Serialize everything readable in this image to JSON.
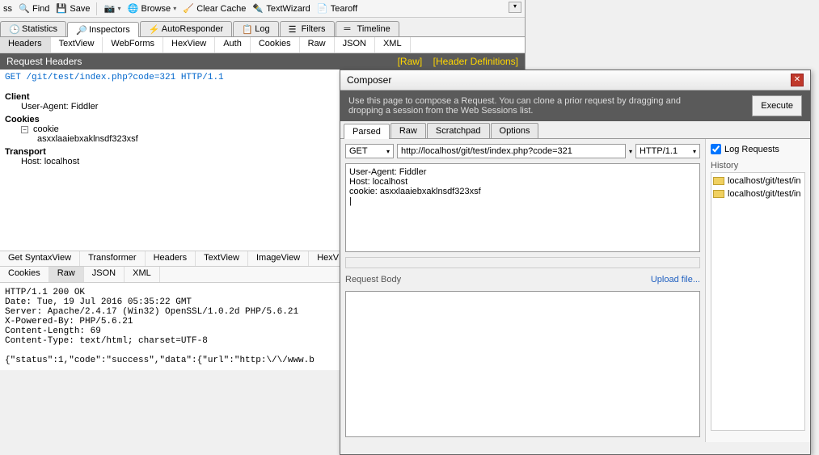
{
  "toolbar": {
    "ss_label": "ss",
    "find_label": "Find",
    "save_label": "Save",
    "browse_label": "Browse",
    "clearcache_label": "Clear Cache",
    "textwizard_label": "TextWizard",
    "tearoff_label": "Tearoff"
  },
  "top_tabs": {
    "statistics": "Statistics",
    "inspectors": "Inspectors",
    "autoresponder": "AutoResponder",
    "log": "Log",
    "filters": "Filters",
    "timeline": "Timeline"
  },
  "req_subtabs": [
    "Headers",
    "TextView",
    "WebForms",
    "HexView",
    "Auth",
    "Cookies",
    "Raw",
    "JSON",
    "XML"
  ],
  "section": {
    "title": "Request Headers",
    "raw_link": "[Raw]",
    "defs_link": "[Header Definitions]"
  },
  "request_line": "GET /git/test/index.php?code=321 HTTP/1.1",
  "tree": {
    "client": "Client",
    "ua_label": "User-Agent: Fiddler",
    "cookies": "Cookies",
    "cookie_node": "cookie",
    "cookie_val": "asxxlaaiebxaklnsdf323xsf",
    "transport": "Transport",
    "host": "Host: localhost"
  },
  "resp_subtabs1": [
    "Get SyntaxView",
    "Transformer",
    "Headers",
    "TextView",
    "ImageView",
    "HexV"
  ],
  "resp_subtabs2": [
    "Cookies",
    "Raw",
    "JSON",
    "XML"
  ],
  "response_text": "HTTP/1.1 200 OK\nDate: Tue, 19 Jul 2016 05:35:22 GMT\nServer: Apache/2.4.17 (Win32) OpenSSL/1.0.2d PHP/5.6.21\nX-Powered-By: PHP/5.6.21\nContent-Length: 69\nContent-Type: text/html; charset=UTF-8\n\n{\"status\":1,\"code\":\"success\",\"data\":{\"url\":\"http:\\/\\/www.b",
  "composer": {
    "title": "Composer",
    "banner": "Use this page to compose a Request. You can clone a prior request by dragging and dropping a session from the Web Sessions list.",
    "execute": "Execute",
    "tabs": [
      "Parsed",
      "Raw",
      "Scratchpad",
      "Options"
    ],
    "method": "GET",
    "url": "http://localhost/git/test/index.php?code=321",
    "protocol": "HTTP/1.1",
    "headers": "User-Agent: Fiddler\nHost: localhost\ncookie: asxxlaaiebxaklnsdf323xsf\n|",
    "req_body_label": "Request Body",
    "upload_link": "Upload file...",
    "log_requests": "Log Requests",
    "history_label": "History",
    "history": [
      "localhost/git/test/in",
      "localhost/git/test/in"
    ]
  }
}
